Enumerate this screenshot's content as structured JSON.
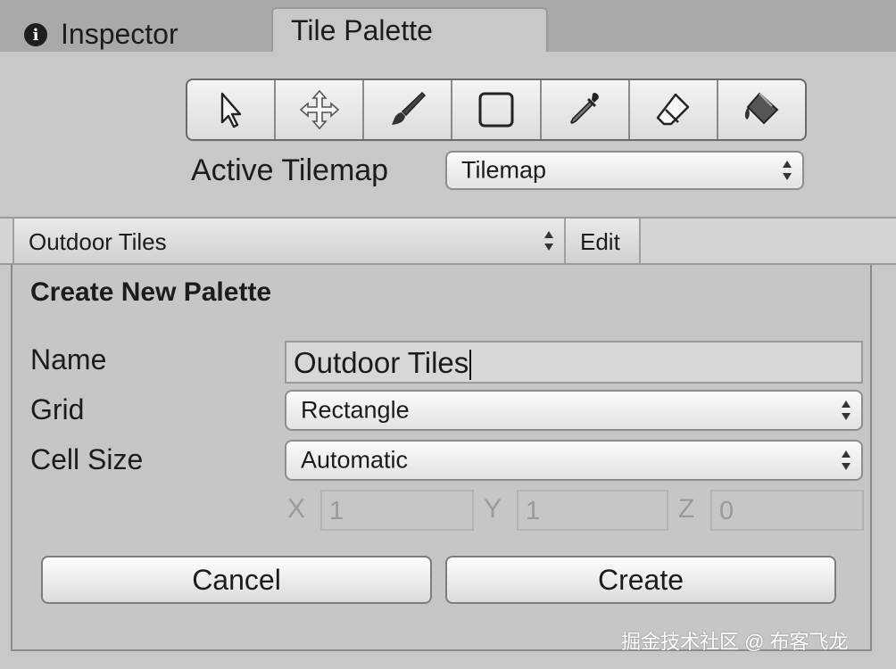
{
  "tabs": {
    "inspector_icon_letter": "i",
    "inspector_label": "Inspector",
    "tile_palette_label": "Tile Palette"
  },
  "toolbar": {
    "tools": [
      {
        "name": "select-tool",
        "icon": "arrow-cursor-icon"
      },
      {
        "name": "move-tool",
        "icon": "move-arrows-icon"
      },
      {
        "name": "paint-tool",
        "icon": "paintbrush-icon"
      },
      {
        "name": "box-fill-tool",
        "icon": "square-icon"
      },
      {
        "name": "pick-tool",
        "icon": "eyedropper-icon"
      },
      {
        "name": "erase-tool",
        "icon": "eraser-icon"
      },
      {
        "name": "flood-fill-tool",
        "icon": "paint-bucket-icon"
      }
    ]
  },
  "active_tilemap": {
    "label": "Active Tilemap",
    "value": "Tilemap"
  },
  "palette_bar": {
    "selected_palette": "Outdoor Tiles",
    "edit_label": "Edit"
  },
  "create_palette": {
    "title": "Create New Palette",
    "name_label": "Name",
    "name_value": "Outdoor Tiles",
    "grid_label": "Grid",
    "grid_value": "Rectangle",
    "cell_size_label": "Cell Size",
    "cell_size_value": "Automatic",
    "x_label": "X",
    "x_value": "1",
    "y_label": "Y",
    "y_value": "1",
    "z_label": "Z",
    "z_value": "0",
    "cancel_label": "Cancel",
    "create_label": "Create"
  },
  "watermark": "掘金技术社区 @ 布客飞龙"
}
